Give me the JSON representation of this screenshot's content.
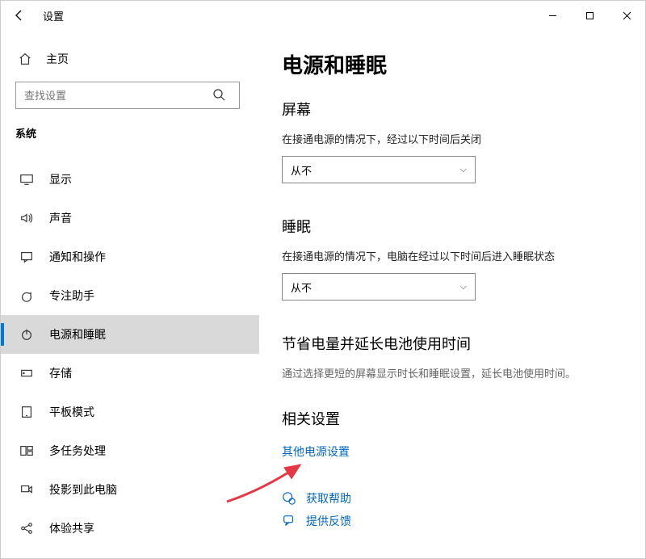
{
  "window": {
    "title": "设置"
  },
  "sidebar": {
    "home": "主页",
    "search_placeholder": "查找设置",
    "section": "系统",
    "items": [
      {
        "label": "显示"
      },
      {
        "label": "声音"
      },
      {
        "label": "通知和操作"
      },
      {
        "label": "专注助手"
      },
      {
        "label": "电源和睡眠"
      },
      {
        "label": "存储"
      },
      {
        "label": "平板模式"
      },
      {
        "label": "多任务处理"
      },
      {
        "label": "投影到此电脑"
      },
      {
        "label": "体验共享"
      }
    ]
  },
  "main": {
    "title": "电源和睡眠",
    "screen": {
      "heading": "屏幕",
      "desc": "在接通电源的情况下，经过以下时间后关闭",
      "value": "从不"
    },
    "sleep": {
      "heading": "睡眠",
      "desc": "在接通电源的情况下，电脑在经过以下时间后进入睡眠状态",
      "value": "从不"
    },
    "save": {
      "heading": "节省电量并延长电池使用时间",
      "desc": "通过选择更短的屏幕显示时长和睡眠设置，延长电池使用时间。"
    },
    "related": {
      "heading": "相关设置",
      "link": "其他电源设置"
    },
    "support": {
      "help": "获取帮助",
      "feedback": "提供反馈"
    }
  }
}
